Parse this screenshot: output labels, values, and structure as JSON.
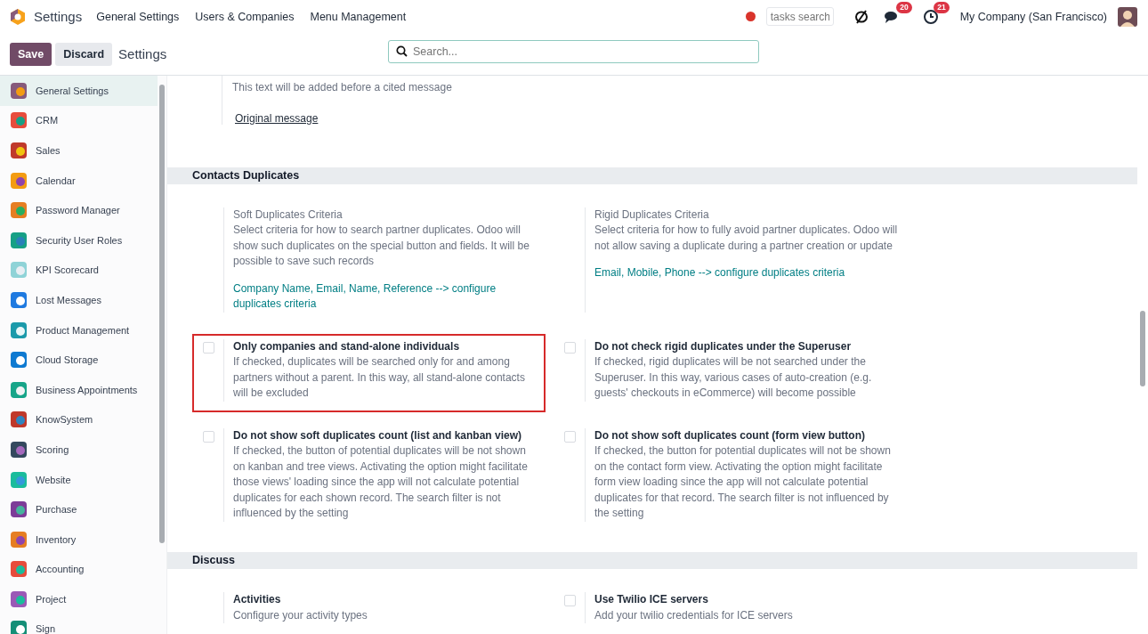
{
  "navbar": {
    "app_name": "Settings",
    "menu": [
      "General Settings",
      "Users & Companies",
      "Menu Management"
    ],
    "tasks_search": {
      "placeholder": "tasks search"
    },
    "messages_badge": "20",
    "activities_badge": "21",
    "company": "My Company (San Francisco)"
  },
  "control_panel": {
    "save": "Save",
    "discard": "Discard",
    "breadcrumb": "Settings",
    "search": {
      "placeholder": "Search..."
    }
  },
  "sidebar": {
    "items": [
      {
        "label": "General Settings",
        "selected": true
      },
      {
        "label": "CRM",
        "selected": false
      },
      {
        "label": "Sales",
        "selected": false
      },
      {
        "label": "Calendar",
        "selected": false
      },
      {
        "label": "Password Manager",
        "selected": false
      },
      {
        "label": "Security User Roles",
        "selected": false
      },
      {
        "label": "KPI Scorecard",
        "selected": false
      },
      {
        "label": "Lost Messages",
        "selected": false
      },
      {
        "label": "Product Management",
        "selected": false
      },
      {
        "label": "Cloud Storage",
        "selected": false
      },
      {
        "label": "Business Appointments",
        "selected": false
      },
      {
        "label": "KnowSystem",
        "selected": false
      },
      {
        "label": "Scoring",
        "selected": false
      },
      {
        "label": "Website",
        "selected": false
      },
      {
        "label": "Purchase",
        "selected": false
      },
      {
        "label": "Inventory",
        "selected": false
      },
      {
        "label": "Accounting",
        "selected": false
      },
      {
        "label": "Project",
        "selected": false
      },
      {
        "label": "Sign",
        "selected": false
      }
    ]
  },
  "content": {
    "top_fragment": {
      "description": "This text will be added before a cited message",
      "value": "Original message"
    },
    "sections": [
      {
        "title": "Contacts Duplicates",
        "settings": [
          {
            "kind": "criteria",
            "title": "Soft Duplicates Criteria",
            "description": "Select criteria for how to search partner duplicates. Odoo will show such duplicates on the special button and fields. It will be possible to save such records",
            "link": "Company Name, Email, Name, Reference --> configure duplicates criteria"
          },
          {
            "kind": "criteria",
            "title": "Rigid Duplicates Criteria",
            "description": "Select criteria for how to fully avoid partner duplicates. Odoo will not allow saving a duplicate during a partner creation or update",
            "link": "Email, Mobile, Phone --> configure duplicates criteria"
          },
          {
            "kind": "checkbox",
            "title": "Only companies and stand-alone individuals",
            "description": "If checked, duplicates will be searched only for and among partners without a parent. In this way, all stand-alone contacts will be excluded",
            "checked": false,
            "highlighted": true
          },
          {
            "kind": "checkbox",
            "title": "Do not check rigid duplicates under the Superuser",
            "description": "If checked, rigid duplicates will be not searched under the Superuser. In this way, various cases of auto-creation (e.g. guests' checkouts in eCommerce) will become possible",
            "checked": false,
            "highlighted": false
          },
          {
            "kind": "checkbox",
            "title": "Do not show soft duplicates count (list and kanban view)",
            "description": "If checked, the button of potential duplicates will be not shown on kanban and tree views. Activating the option might facilitate those views' loading since the app will not calculate potential duplicates for each shown record. The search filter is not influenced by the setting",
            "checked": false,
            "highlighted": false
          },
          {
            "kind": "checkbox",
            "title": "Do not show soft duplicates count (form view button)",
            "description": "If checked, the button for potential duplicates will not be shown on the contact form view. Activating the option might facilitate form view loading since the app will not calculate potential duplicates for that record. The search filter is not influenced by the setting",
            "checked": false,
            "highlighted": false
          }
        ]
      },
      {
        "title": "Discuss",
        "settings": [
          {
            "kind": "plain",
            "title": "Activities",
            "description": "Configure your activity types"
          },
          {
            "kind": "checkbox",
            "title": "Use Twilio ICE servers",
            "description": "Add your twilio credentials for ICE servers",
            "checked": false,
            "highlighted": false
          }
        ]
      }
    ]
  }
}
